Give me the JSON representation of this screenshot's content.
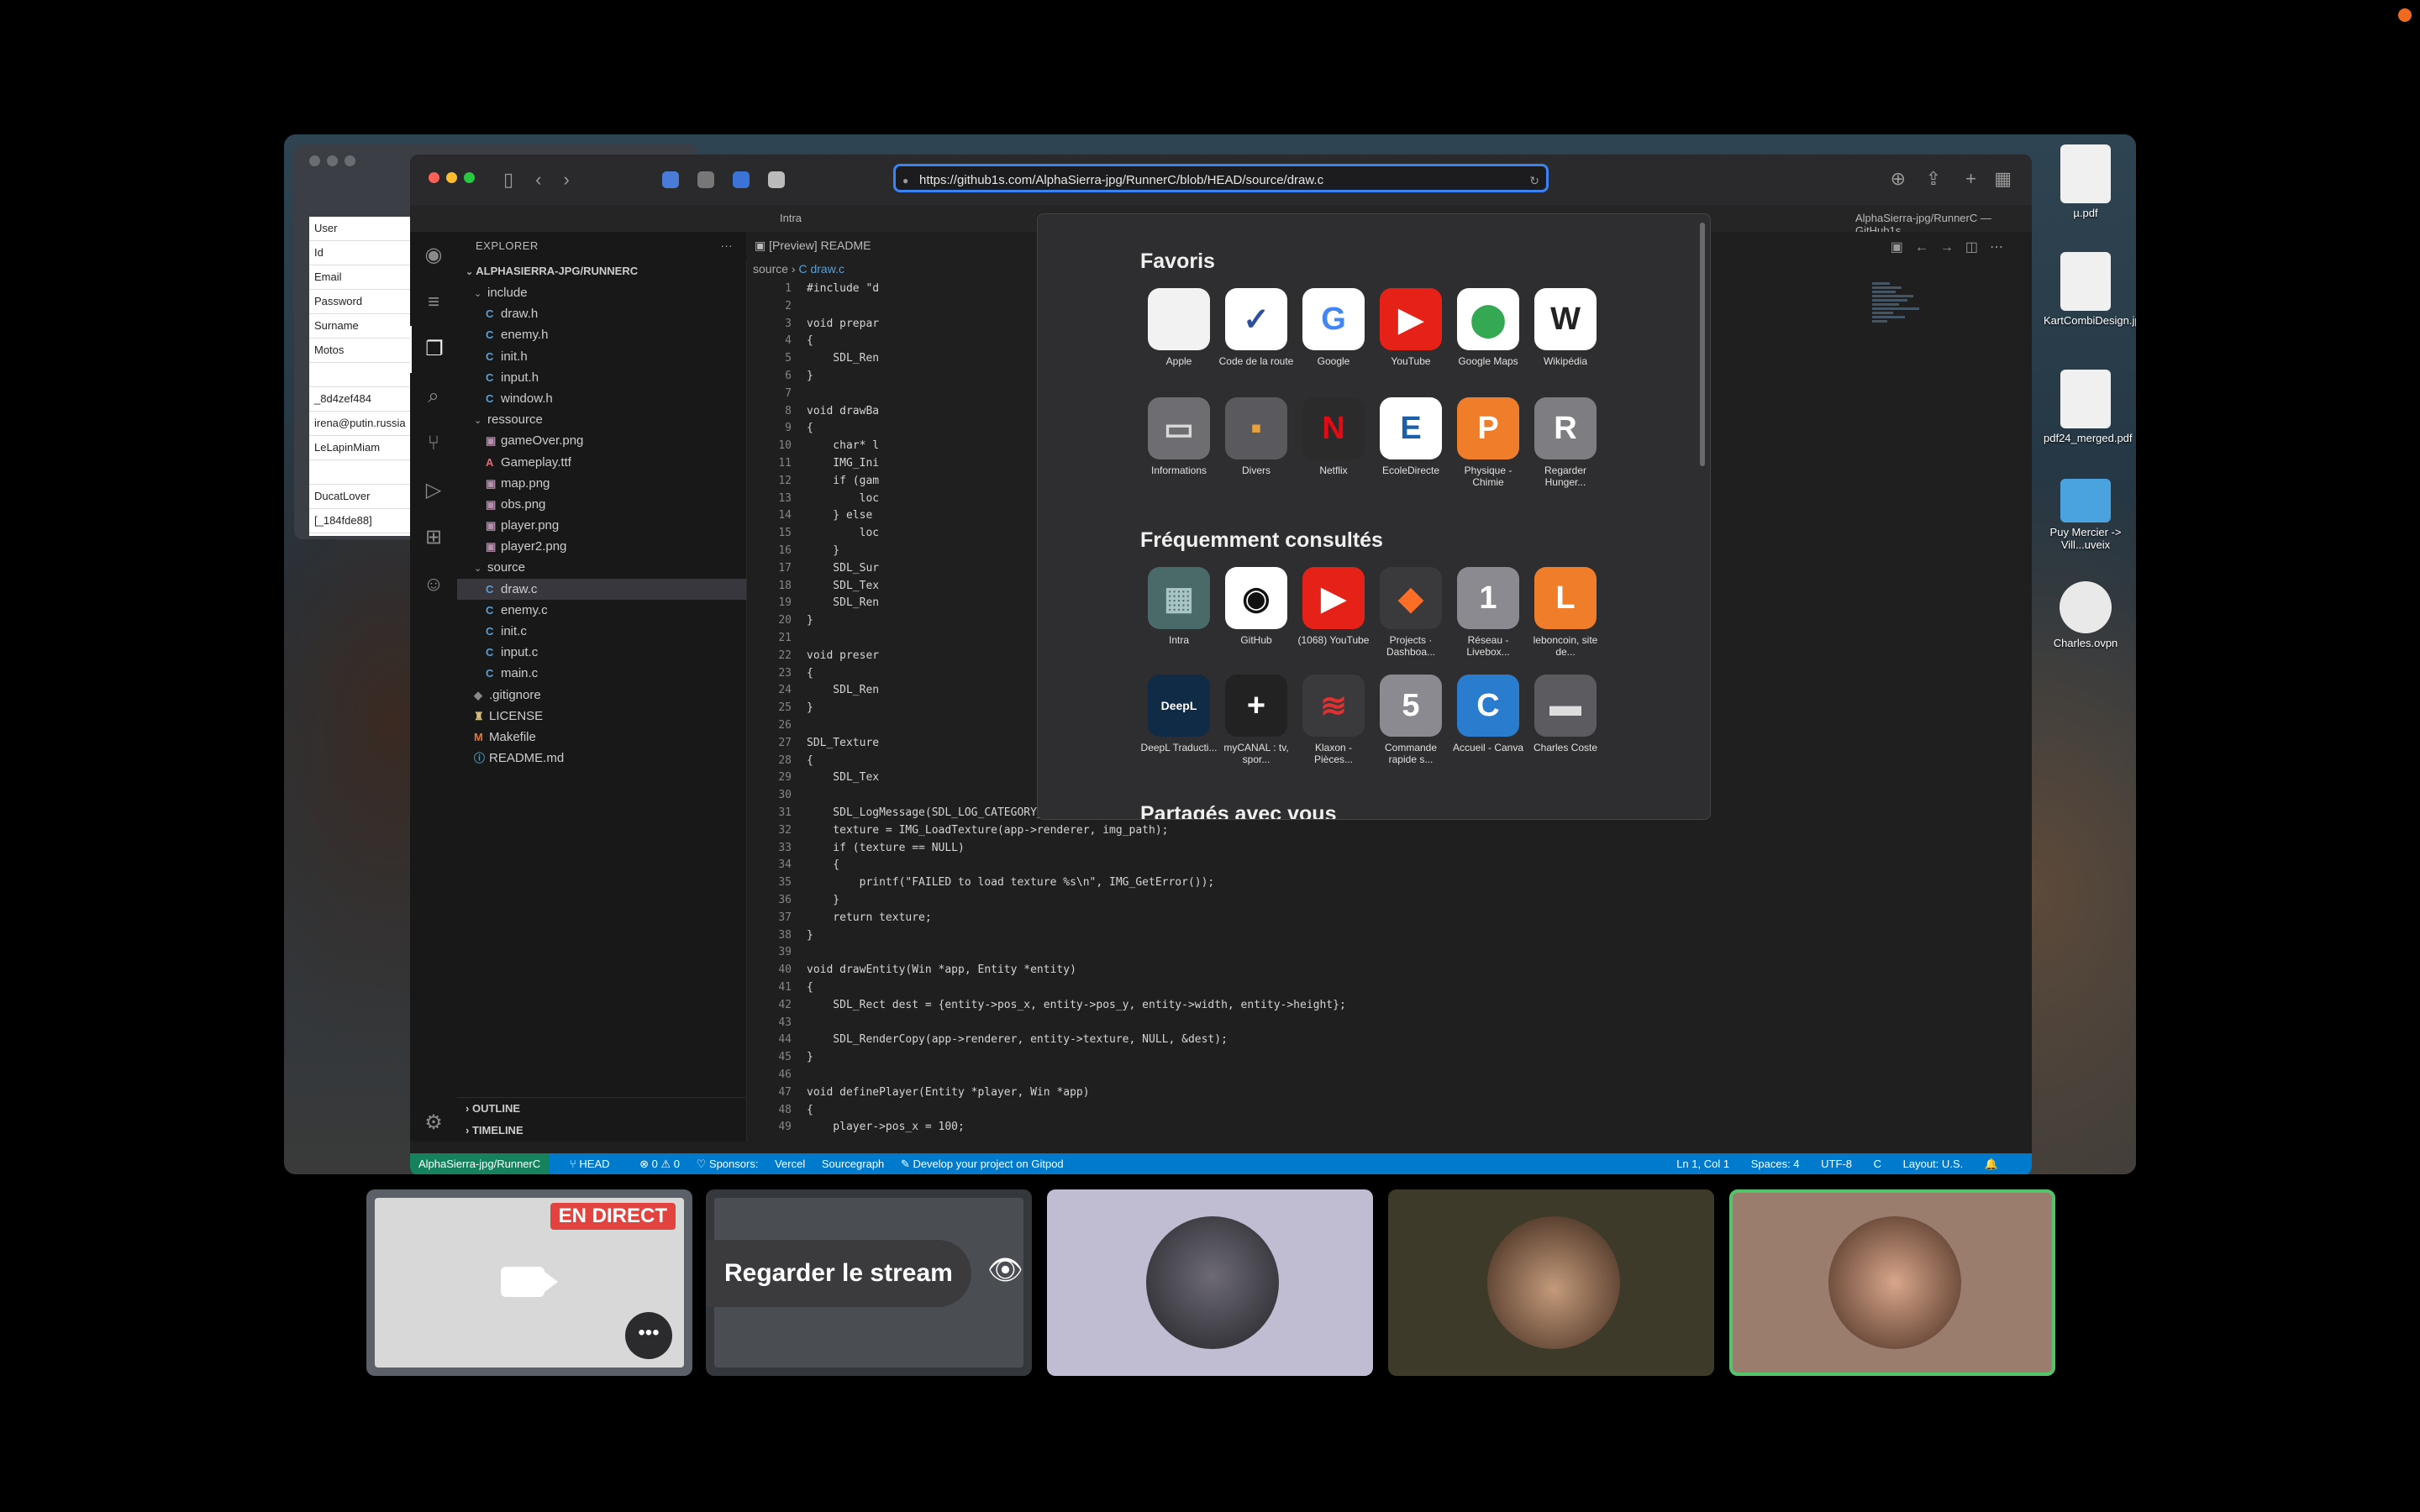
{
  "browser": {
    "url": "https://github1s.com/AlphaSierra-jpg/RunnerC/blob/HEAD/source/draw.c",
    "tab_left": "Intra",
    "tab_right": "AlphaSierra-jpg/RunnerC — GitHub1s"
  },
  "left_window": {
    "fields": [
      "User",
      "Id",
      "Email",
      "Password",
      "Surname",
      "Motos",
      "",
      "_8d4zef484",
      "irena@putin.russia",
      "LeLapinMiam",
      "",
      "DucatLover",
      "[_184fde88]"
    ]
  },
  "explorer": {
    "header": "EXPLORER",
    "more": "···",
    "project": "ALPHASIERRA-JPG/RUNNERC",
    "tree": [
      {
        "label": "include",
        "type": "folder",
        "depth": 1
      },
      {
        "label": "draw.h",
        "type": "c",
        "depth": 2
      },
      {
        "label": "enemy.h",
        "type": "c",
        "depth": 2
      },
      {
        "label": "init.h",
        "type": "c",
        "depth": 2
      },
      {
        "label": "input.h",
        "type": "c",
        "depth": 2
      },
      {
        "label": "window.h",
        "type": "c",
        "depth": 2
      },
      {
        "label": "ressource",
        "type": "folder",
        "depth": 1
      },
      {
        "label": "gameOver.png",
        "type": "img",
        "depth": 2
      },
      {
        "label": "Gameplay.ttf",
        "type": "ttf",
        "depth": 2
      },
      {
        "label": "map.png",
        "type": "img",
        "depth": 2
      },
      {
        "label": "obs.png",
        "type": "img",
        "depth": 2
      },
      {
        "label": "player.png",
        "type": "img",
        "depth": 2
      },
      {
        "label": "player2.png",
        "type": "img",
        "depth": 2
      },
      {
        "label": "source",
        "type": "folder",
        "depth": 1
      },
      {
        "label": "draw.c",
        "type": "c",
        "depth": 2,
        "selected": true
      },
      {
        "label": "enemy.c",
        "type": "c",
        "depth": 2
      },
      {
        "label": "init.c",
        "type": "c",
        "depth": 2
      },
      {
        "label": "input.c",
        "type": "c",
        "depth": 2
      },
      {
        "label": "main.c",
        "type": "c",
        "depth": 2
      },
      {
        "label": ".gitignore",
        "type": "git",
        "depth": 1
      },
      {
        "label": "LICENSE",
        "type": "lic",
        "depth": 1
      },
      {
        "label": "Makefile",
        "type": "mk",
        "depth": 1
      },
      {
        "label": "README.md",
        "type": "md",
        "depth": 1
      }
    ],
    "outline": "OUTLINE",
    "timeline": "TIMELINE"
  },
  "editor": {
    "preview_tab": "[Preview] README",
    "breadcrumb": [
      "source",
      "C draw.c"
    ],
    "lines": [
      {
        "n": "1",
        "t": "#include \"d"
      },
      {
        "n": "2",
        "t": ""
      },
      {
        "n": "3",
        "t": "void prepar"
      },
      {
        "n": "4",
        "t": "{"
      },
      {
        "n": "5",
        "t": "    SDL_Ren"
      },
      {
        "n": "6",
        "t": "}"
      },
      {
        "n": "7",
        "t": ""
      },
      {
        "n": "8",
        "t": "void drawBa"
      },
      {
        "n": "9",
        "t": "{"
      },
      {
        "n": "10",
        "t": "    char* l"
      },
      {
        "n": "11",
        "t": "    IMG_Ini"
      },
      {
        "n": "12",
        "t": "    if (gam"
      },
      {
        "n": "13",
        "t": "        loc"
      },
      {
        "n": "14",
        "t": "    } else"
      },
      {
        "n": "15",
        "t": "        loc"
      },
      {
        "n": "16",
        "t": "    }"
      },
      {
        "n": "17",
        "t": "    SDL_Sur"
      },
      {
        "n": "18",
        "t": "    SDL_Tex"
      },
      {
        "n": "19",
        "t": "    SDL_Ren"
      },
      {
        "n": "20",
        "t": "}"
      },
      {
        "n": "21",
        "t": ""
      },
      {
        "n": "22",
        "t": "void preser"
      },
      {
        "n": "23",
        "t": "{"
      },
      {
        "n": "24",
        "t": "    SDL_Ren"
      },
      {
        "n": "25",
        "t": "}"
      },
      {
        "n": "26",
        "t": ""
      },
      {
        "n": "27",
        "t": "SDL_Texture"
      },
      {
        "n": "28",
        "t": "{"
      },
      {
        "n": "29",
        "t": "    SDL_Tex"
      },
      {
        "n": "30",
        "t": ""
      },
      {
        "n": "31",
        "t": "    SDL_LogMessage(SDL_LOG_CATEGORY_APPLICATION, SDL_LOG_PRIORITY_INFO, \"Loading: %s\", img_path);"
      },
      {
        "n": "32",
        "t": "    texture = IMG_LoadTexture(app->renderer, img_path);"
      },
      {
        "n": "33",
        "t": "    if (texture == NULL)"
      },
      {
        "n": "34",
        "t": "    {"
      },
      {
        "n": "35",
        "t": "        printf(\"FAILED to load texture %s\\n\", IMG_GetError());"
      },
      {
        "n": "36",
        "t": "    }"
      },
      {
        "n": "37",
        "t": "    return texture;"
      },
      {
        "n": "38",
        "t": "}"
      },
      {
        "n": "39",
        "t": ""
      },
      {
        "n": "40",
        "t": "void drawEntity(Win *app, Entity *entity)"
      },
      {
        "n": "41",
        "t": "{"
      },
      {
        "n": "42",
        "t": "    SDL_Rect dest = {entity->pos_x, entity->pos_y, entity->width, entity->height};"
      },
      {
        "n": "43",
        "t": ""
      },
      {
        "n": "44",
        "t": "    SDL_RenderCopy(app->renderer, entity->texture, NULL, &dest);"
      },
      {
        "n": "45",
        "t": "}"
      },
      {
        "n": "46",
        "t": ""
      },
      {
        "n": "47",
        "t": "void definePlayer(Entity *player, Win *app)"
      },
      {
        "n": "48",
        "t": "{"
      },
      {
        "n": "49",
        "t": "    player->pos_x = 100;"
      }
    ]
  },
  "statusbar": {
    "repo": "AlphaSierra-jpg/RunnerC",
    "branch": "HEAD",
    "problems": "⊗ 0 ⚠ 0",
    "sponsors": "♡ Sponsors:",
    "vercel": "Vercel",
    "sourcegraph": "Sourcegraph",
    "gitpod": "Develop your project on Gitpod",
    "position": "Ln 1, Col 1",
    "spaces": "Spaces: 4",
    "encoding": "UTF-8",
    "language": "C",
    "layout": "Layout: U.S."
  },
  "favorites": {
    "title": "Favoris",
    "row1": [
      {
        "label": "Apple",
        "icon": "apple-icon",
        "glyph": "",
        "bg": "#f2f2f2",
        "fg": "#333"
      },
      {
        "label": "Code de la route",
        "icon": "code-route-icon",
        "glyph": "✓",
        "bg": "#ffffff",
        "fg": "#2d4f9e"
      },
      {
        "label": "Google",
        "icon": "google-icon",
        "glyph": "G",
        "bg": "#ffffff",
        "fg": "#4285f4"
      },
      {
        "label": "YouTube",
        "icon": "youtube-icon",
        "glyph": "▶",
        "bg": "#e62117",
        "fg": "#ffffff"
      },
      {
        "label": "Google Maps",
        "icon": "maps-icon",
        "glyph": "⬤",
        "bg": "#ffffff",
        "fg": "#34a853"
      },
      {
        "label": "Wikipédia",
        "icon": "wikipedia-icon",
        "glyph": "W",
        "bg": "#ffffff",
        "fg": "#222"
      }
    ],
    "row2": [
      {
        "label": "Informations",
        "icon": "folder-icon",
        "glyph": "▭",
        "bg": "#6d6d72",
        "fg": "#d9d9d9"
      },
      {
        "label": "Divers",
        "icon": "folder-icon",
        "glyph": "▪",
        "bg": "#5a5a5e",
        "fg": "#e7a23c"
      },
      {
        "label": "Netflix",
        "icon": "netflix-icon",
        "glyph": "N",
        "bg": "#2b2b2b",
        "fg": "#e50914"
      },
      {
        "label": "EcoleDirecte",
        "icon": "ecoledirecte-icon",
        "glyph": "E",
        "bg": "#ffffff",
        "fg": "#1b5fa8"
      },
      {
        "label": "Physique - Chimie",
        "icon": "letter-p-icon",
        "glyph": "P",
        "bg": "#ef7d2a",
        "fg": "#ffffff"
      },
      {
        "label": "Regarder Hunger...",
        "icon": "letter-r-icon",
        "glyph": "R",
        "bg": "#7d7d82",
        "fg": "#ffffff"
      }
    ]
  },
  "frequent": {
    "title": "Fréquemment consultés",
    "row1": [
      {
        "label": "Intra",
        "icon": "intra-icon",
        "glyph": "▦",
        "bg": "#4a6a6a",
        "fg": "#a9c4c4"
      },
      {
        "label": "GitHub",
        "icon": "github-icon",
        "glyph": "◉",
        "bg": "#ffffff",
        "fg": "#111"
      },
      {
        "label": "(1068) YouTube",
        "icon": "youtube-icon",
        "glyph": "▶",
        "bg": "#e62117",
        "fg": "#ffffff"
      },
      {
        "label": "Projects · Dashboa...",
        "icon": "gitlab-icon",
        "glyph": "◆",
        "bg": "#3a3a3c",
        "fg": "#fc6d26"
      },
      {
        "label": "Réseau - Livebox...",
        "icon": "number-1-icon",
        "glyph": "1",
        "bg": "#8a8a90",
        "fg": "#ffffff"
      },
      {
        "label": "leboncoin, site de...",
        "icon": "letter-l-icon",
        "glyph": "L",
        "bg": "#ef7d2a",
        "fg": "#ffffff"
      }
    ],
    "row2": [
      {
        "label": "DeepL Traducti...",
        "icon": "deepl-icon",
        "glyph": "DeepL",
        "bg": "#0f2b46",
        "fg": "#ffffff"
      },
      {
        "label": "myCANAL : tv, spor...",
        "icon": "plus-icon",
        "glyph": "+",
        "bg": "#222222",
        "fg": "#ffffff"
      },
      {
        "label": "Klaxon - Pièces...",
        "icon": "klaxon-icon",
        "glyph": "≋",
        "bg": "#3a3a3c",
        "fg": "#e03030"
      },
      {
        "label": "Commande rapide s...",
        "icon": "number-5-icon",
        "glyph": "5",
        "bg": "#8a8a90",
        "fg": "#ffffff"
      },
      {
        "label": "Accueil - Canva",
        "icon": "canva-icon",
        "glyph": "C",
        "bg": "#2a7ccf",
        "fg": "#ffffff"
      },
      {
        "label": "Charles Coste",
        "icon": "briefcase-icon",
        "glyph": "▬",
        "bg": "#5c5c60",
        "fg": "#ddd"
      }
    ],
    "next_section": "Partagés avec vous"
  },
  "desktop": [
    {
      "label": "µ.pdf",
      "icon": "pdf-icon"
    },
    {
      "label": "KartCombiDesign.jpg",
      "icon": "image-icon"
    },
    {
      "label": "pdf24_merged.pdf",
      "icon": "pdf-icon"
    },
    {
      "label": "Puy Mercier -> Vill...uveix",
      "icon": "folder-icon"
    },
    {
      "label": "Charles.ovpn",
      "icon": "vpn-icon"
    }
  ],
  "call": {
    "live_badge": "EN DIRECT",
    "watch_label": "Regarder le stream",
    "more": "•••"
  }
}
